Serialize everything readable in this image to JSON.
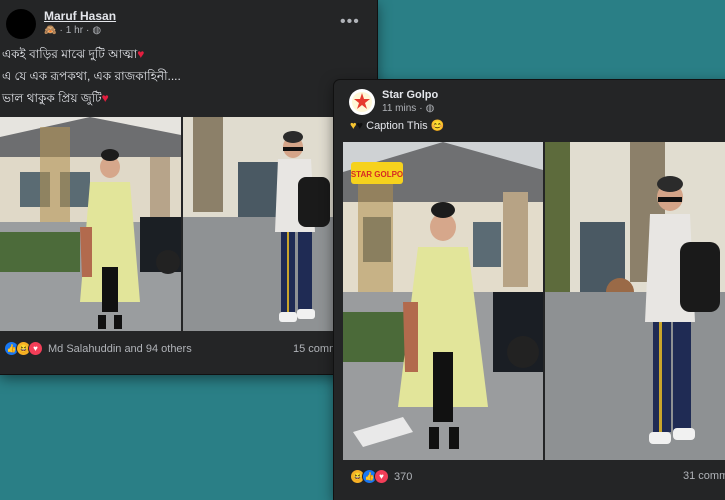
{
  "post1": {
    "author": "Maruf Hasan",
    "time": "1 hr",
    "caption_lines": [
      "একই বাড়ির মাঝে দুটি আত্মা",
      "এ যে এক রূপকথা, এক রাজকাহিনী....",
      "ভাল থাকুক প্রিয় জুটি"
    ],
    "reactions_text": "Md Salahuddin and 94 others",
    "comments_text": "15 comm",
    "reaction_icons": [
      "like-icon",
      "haha-icon",
      "love-icon"
    ]
  },
  "post2": {
    "author": "Star Golpo",
    "time": "11 mins",
    "caption": "Caption This",
    "logo_text": "STAR GOLPO",
    "watermark": "STAR GOLPO",
    "reactions_count": "370",
    "comments_text": "31 comm",
    "reaction_icons": [
      "haha-icon",
      "like-icon",
      "love-icon"
    ]
  },
  "colors": {
    "background": "#2a7f86",
    "card": "#242526",
    "heart": "#e41e3f",
    "like": "#1877f2"
  }
}
